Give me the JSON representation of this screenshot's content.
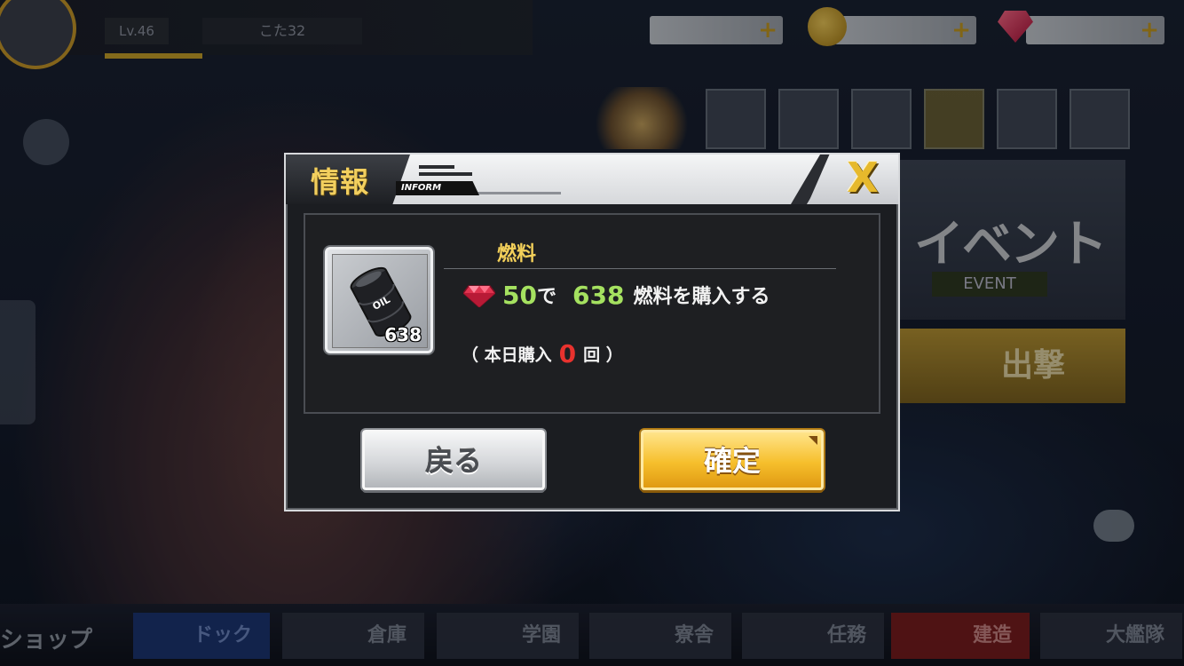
{
  "hud": {
    "level_label": "Lv.46",
    "player_name": "こた32"
  },
  "bottom_nav": {
    "shop": "ショップ",
    "dock": "ドック",
    "depot": "倉庫",
    "academy": "学園",
    "dorm": "寮舎",
    "missions": "任務",
    "build": "建造",
    "fleet": "大艦隊"
  },
  "lobby": {
    "event_banner": "イベント",
    "event_banner_sub": "EVENT",
    "sortie": "出撃"
  },
  "dialog": {
    "title": "情報",
    "subtitle": "INFORM",
    "close_icon": "X",
    "item_name": "燃料",
    "item_count": "638",
    "barrel_label": "OIL",
    "cost_amount": "50",
    "cost_suffix": "で",
    "purchase_amount": "638",
    "purchase_text": "燃料を購入する",
    "today_prefix": "（ 本日購入",
    "today_count": "0",
    "today_suffix": "回 ）",
    "back_label": "戻る",
    "confirm_label": "確定"
  },
  "colors": {
    "accent_gold": "#f2cf5e",
    "value_green": "#a5e160",
    "count_red": "#e8322e"
  }
}
